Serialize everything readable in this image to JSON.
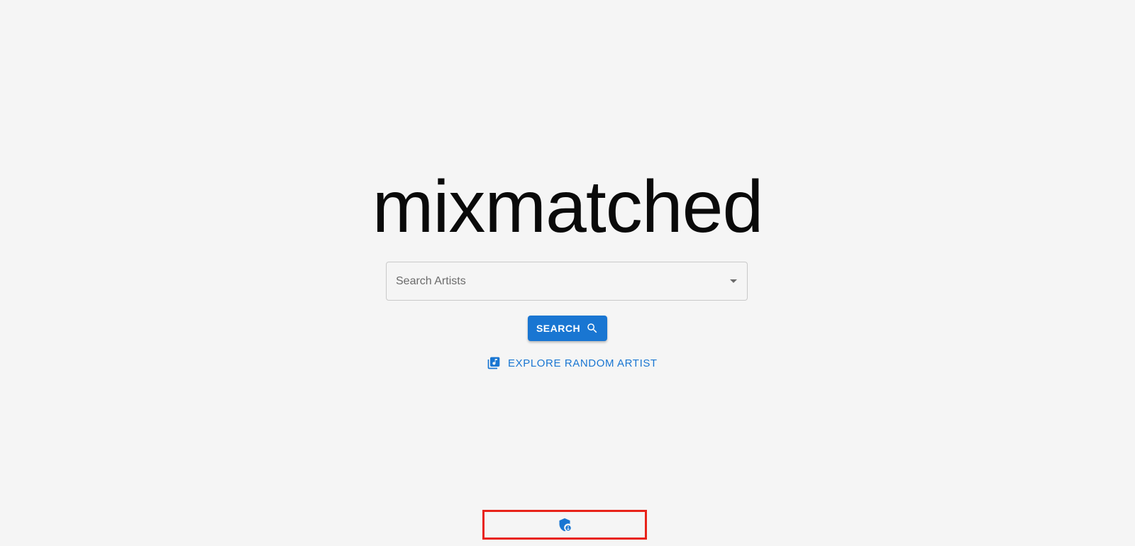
{
  "app": {
    "logo_text": "mixmatched"
  },
  "search": {
    "placeholder": "Search Artists",
    "value": ""
  },
  "buttons": {
    "search_label": "SEARCH",
    "explore_label": "EXPLORE RANDOM ARTIST"
  },
  "icons": {
    "search": "search-icon",
    "explore": "library-music-icon",
    "privacy": "privacy-shield-icon",
    "dropdown": "arrow-drop-down-icon"
  },
  "colors": {
    "primary": "#1976d2",
    "background": "#f5f5f5",
    "highlight_border": "#e8231a",
    "text": "#0a0a0a"
  }
}
